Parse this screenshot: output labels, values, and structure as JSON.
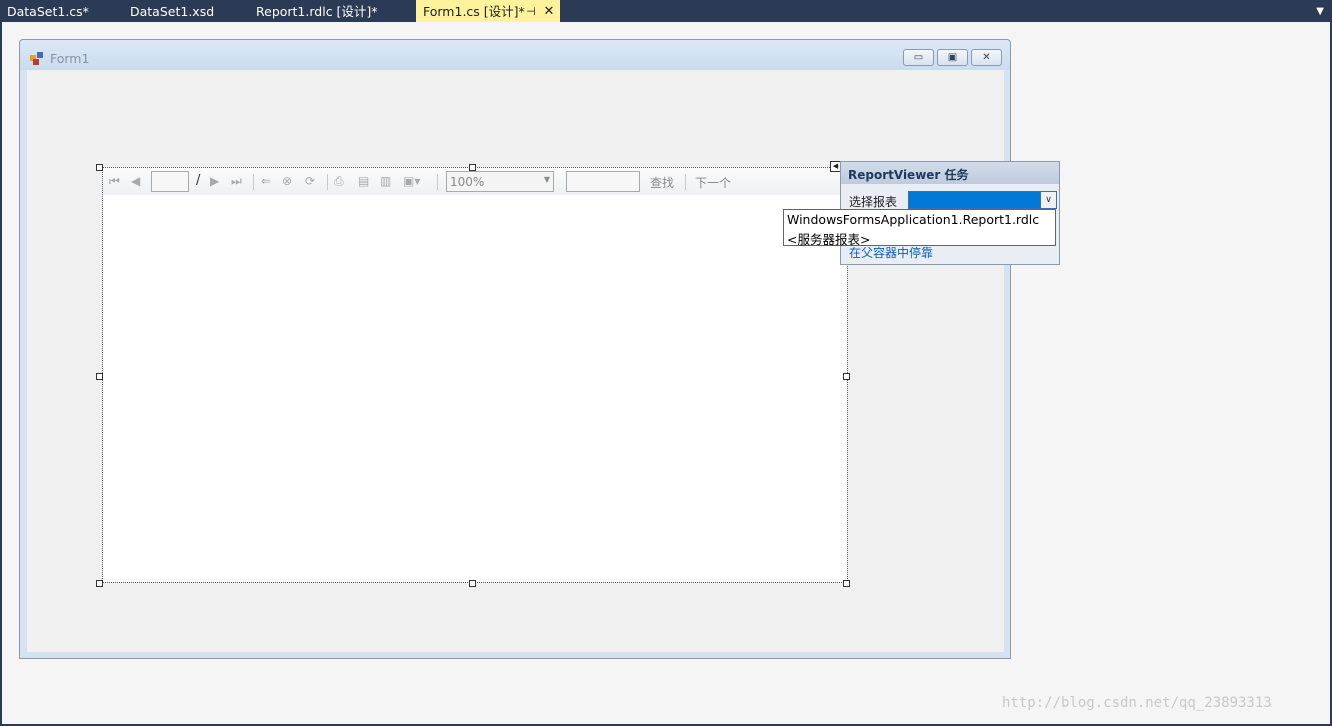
{
  "tabs": [
    {
      "label": "DataSet1.cs*",
      "active": false
    },
    {
      "label": "DataSet1.xsd",
      "active": false
    },
    {
      "label": "Report1.rdlc [设计]*",
      "active": false
    },
    {
      "label": "Form1.cs [设计]*",
      "active": true
    }
  ],
  "form": {
    "title": "Form1",
    "caption_buttons": {
      "minimize": "▭",
      "maximize": "▣",
      "close": "✕"
    }
  },
  "toolbar": {
    "page_separator": "/",
    "zoom": "100%",
    "find_label": "查找",
    "find_next_label": "下一个"
  },
  "tasks_panel": {
    "title": "ReportViewer 任务",
    "choose_report_label": "选择报表",
    "dock_link": "在父容器中停靠"
  },
  "report_dropdown": {
    "options": [
      "WindowsFormsApplication1.Report1.rdlc",
      "<服务器报表>"
    ]
  },
  "watermark": "http://blog.csdn.net/qq_23893313",
  "icons": {
    "first": "first-page-icon",
    "previous": "previous-page-icon",
    "next": "next-page-icon",
    "last": "last-page-icon",
    "back": "back-icon",
    "stop": "stop-icon",
    "refresh": "refresh-icon",
    "print": "print-icon",
    "layout": "print-layout-icon",
    "page_setup": "page-setup-icon",
    "export": "export-icon"
  },
  "colors": {
    "active_tab": "#fff29d",
    "tab_strip": "#2b3a55",
    "selection": "#0078d7",
    "link": "#0b5fb5"
  }
}
